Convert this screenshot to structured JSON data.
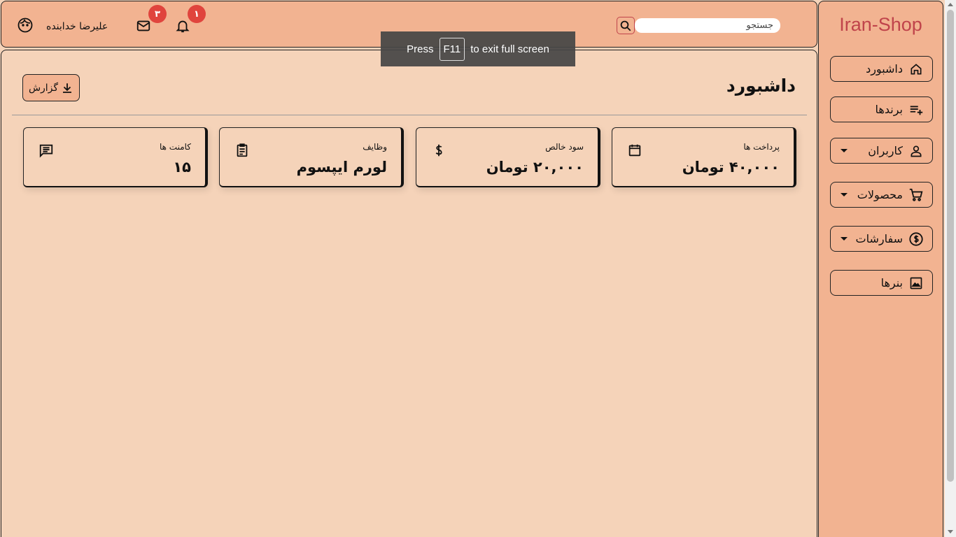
{
  "sidebar": {
    "brand": "Iran-Shop",
    "items": [
      {
        "label": "داشبورد",
        "icon": "home-icon",
        "has_dropdown": false
      },
      {
        "label": "برندها",
        "icon": "playlist-add-icon",
        "has_dropdown": false
      },
      {
        "label": "کاربران",
        "icon": "person-icon",
        "has_dropdown": true
      },
      {
        "label": "محصولات",
        "icon": "cart-icon",
        "has_dropdown": true
      },
      {
        "label": "سفارشات",
        "icon": "dollar-circle-icon",
        "has_dropdown": true
      },
      {
        "label": "بنرها",
        "icon": "image-icon",
        "has_dropdown": false
      }
    ]
  },
  "topbar": {
    "search_placeholder": "جستجو",
    "user_name": "علیرضا خدابنده",
    "messages_badge": "۳",
    "notifications_badge": "۱"
  },
  "fullscreen_toast": {
    "prefix": "Press",
    "key": "F11",
    "suffix": "to exit full screen"
  },
  "main": {
    "title": "داشبورد",
    "report_label": "گزارش",
    "cards": [
      {
        "label": "پرداخت ها",
        "value": "۴۰,۰۰۰ تومان",
        "icon": "calendar-icon"
      },
      {
        "label": "سود خالص",
        "value": "۲۰,۰۰۰ تومان",
        "icon": "dollar-icon"
      },
      {
        "label": "وظایف",
        "value": "لورم ایپسوم",
        "icon": "clipboard-icon"
      },
      {
        "label": "کامنت ها",
        "value": "۱۵",
        "icon": "comment-icon"
      }
    ]
  },
  "colors": {
    "background": "#f5d3b9",
    "panel": "#f2b391",
    "brand": "#c0444b",
    "badge": "#e0443d"
  }
}
